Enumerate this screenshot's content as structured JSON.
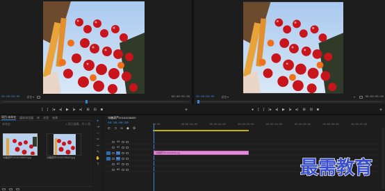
{
  "source_monitor": {
    "timecode": "00:00:00:00",
    "fit": "适合",
    "duration_tc": "00:00:05:00",
    "playhead_fraction": 0.45
  },
  "program_monitor": {
    "timecode": "00:00:00:00",
    "fit": "适合",
    "duration_tc": "00:00:05:00",
    "playhead_fraction": 0.0
  },
  "project_panel": {
    "tabs": [
      {
        "label": "项目:未命名"
      },
      {
        "label": "媒体浏览器"
      },
      {
        "label": "库"
      },
      {
        "label": "信息"
      },
      {
        "label": "效果"
      }
    ],
    "subfolder": "未命名",
    "count": "1 项已选择，共 2 项",
    "bins": [
      {
        "label": "冰糖葫芦20161038400.jpg"
      },
      {
        "label": "冰糖葫芦20161038400.jpg"
      }
    ]
  },
  "timeline": {
    "sequence_tab": "冰糖葫芦20161038400",
    "timecode": "00:00:00:00",
    "ruler": [
      "00:00",
      "00:00:01:00",
      "00:00:02:00",
      "00:00:03:00",
      "00:00:04:00",
      "00:00:05:00",
      "00:00:06:00",
      "00:00:07:00"
    ],
    "tracks": [
      {
        "name": "V3"
      },
      {
        "name": "V2"
      },
      {
        "name": "V1",
        "clip": "冰糖葫芦20161038400.jpg"
      },
      {
        "name": "A1"
      },
      {
        "name": "A2"
      },
      {
        "name": "A3"
      }
    ]
  },
  "watermark": "最需教育",
  "colors": {
    "accent": "#3a86d6",
    "clip": "#e48ad8",
    "work_area": "#c8b400",
    "watermark": "#3a4fd0"
  }
}
